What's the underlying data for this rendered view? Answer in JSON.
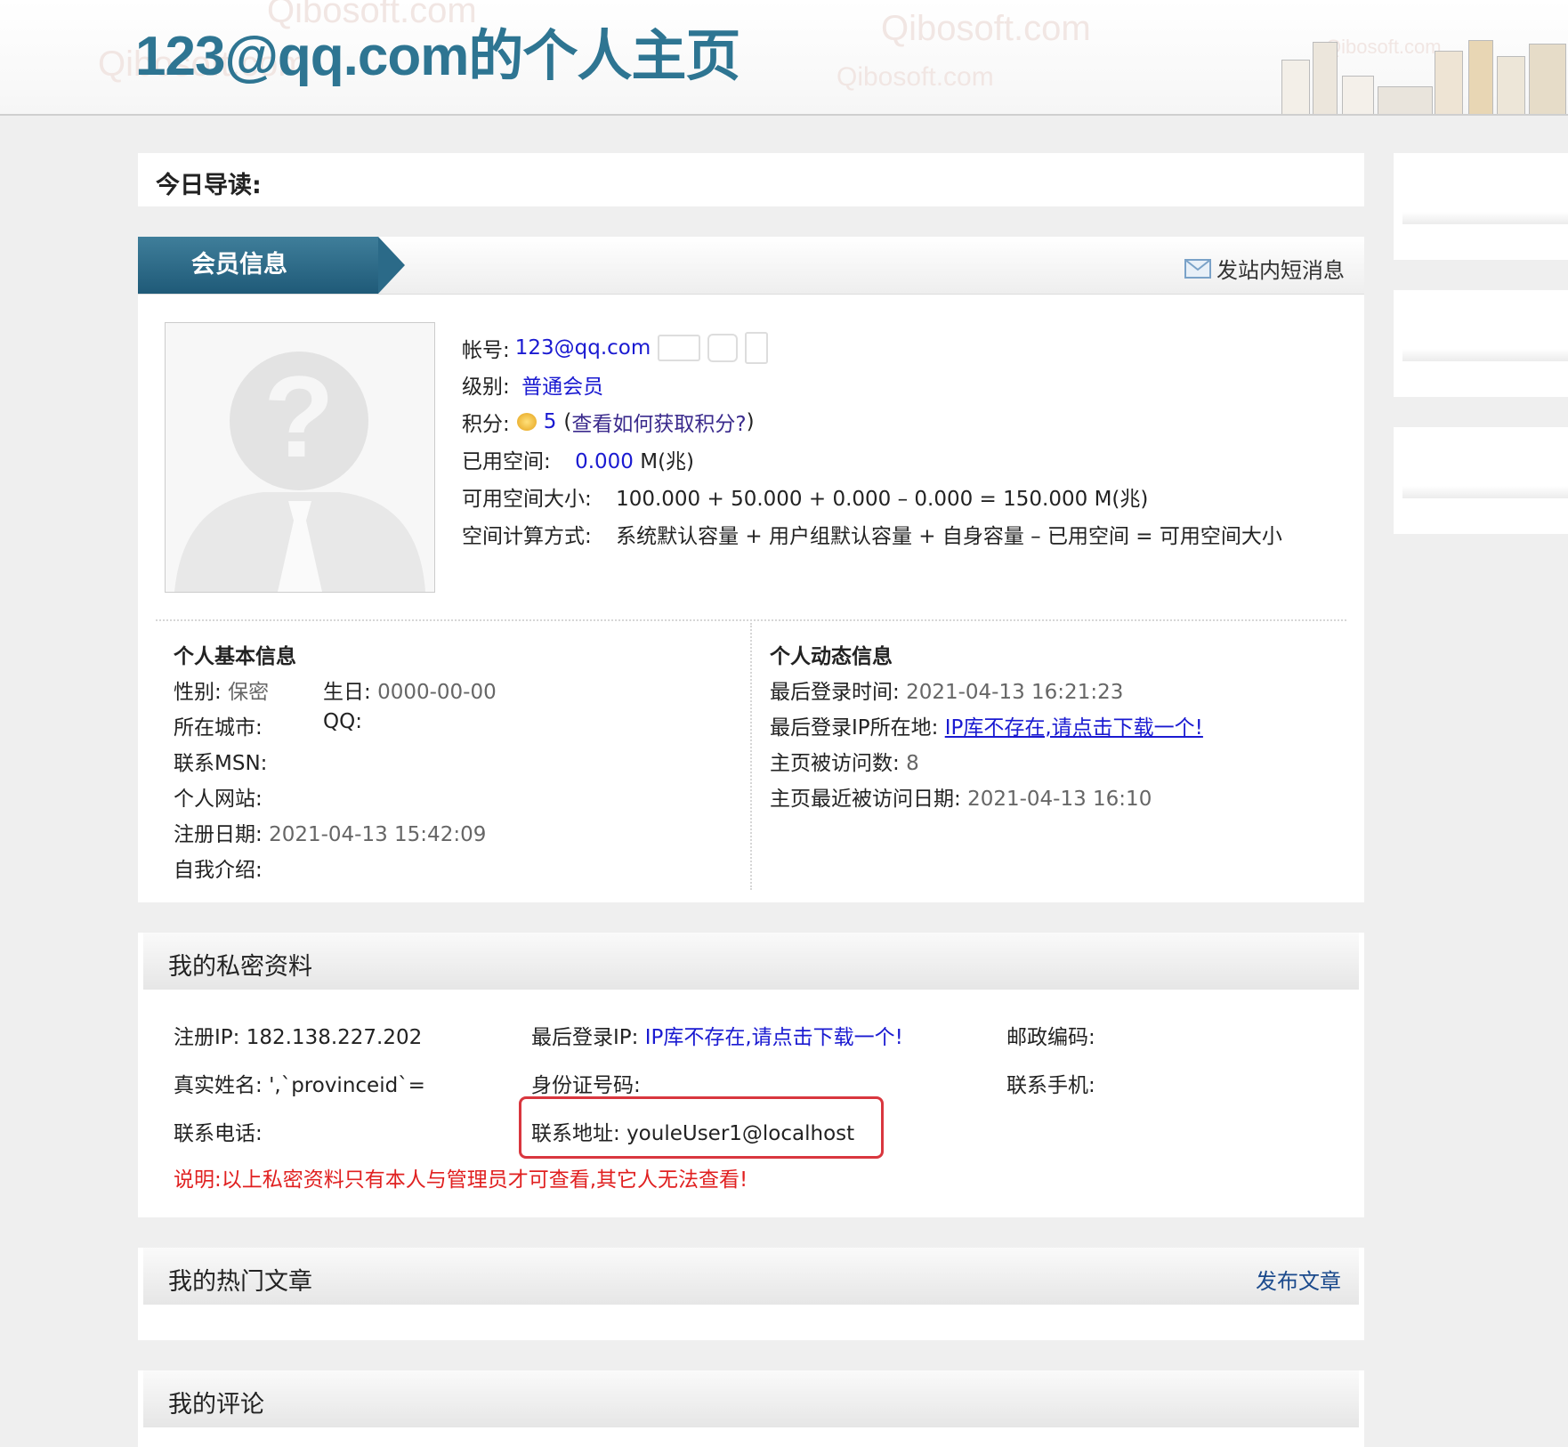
{
  "header": {
    "title": "123@qq.com的个人主页",
    "watermark": "Qibosoft.com"
  },
  "today": {
    "label": "今日导读:"
  },
  "member": {
    "ribbon": "会员信息",
    "message_link": "发站内短消息",
    "account_label": "帐号:",
    "account": "123@qq.com",
    "level_label": "级别:",
    "level": "普通会员",
    "points_label": "积分:",
    "points": "5",
    "points_open": "(",
    "points_link": "查看如何获取积分?",
    "points_close": ")",
    "used_label": "已用空间:",
    "used_value": "0.000",
    "used_unit": "M(兆)",
    "avail_label": "可用空间大小:",
    "avail_value": "100.000 + 50.000 + 0.000 – 0.000 = 150.000 M(兆)",
    "calc_label": "空间计算方式:",
    "calc_value": "系统默认容量 + 用户组默认容量 + 自身容量 – 已用空间 = 可用空间大小"
  },
  "basic": {
    "heading": "个人基本信息",
    "gender_label": "性别:",
    "gender": "保密",
    "birthday_label": "生日:",
    "birthday": "0000-00-00",
    "city_label": "所在城市:",
    "qq_label": "QQ:",
    "msn_label": "联系MSN:",
    "website_label": "个人网站:",
    "reg_label": "注册日期:",
    "reg_date": "2021-04-13 15:42:09",
    "intro_label": "自我介绍:"
  },
  "activity": {
    "heading": "个人动态信息",
    "last_login_label": "最后登录时间:",
    "last_login": "2021-04-13 16:21:23",
    "ip_loc_label": "最后登录IP所在地:",
    "ip_loc_link": "IP库不存在,请点击下载一个!",
    "visits_label": "主页被访问数:",
    "visits": "8",
    "last_visit_label": "主页最近被访问日期:",
    "last_visit": "2021-04-13 16:10"
  },
  "private": {
    "title": "我的私密资料",
    "reg_ip_label": "注册IP:",
    "reg_ip": "182.138.227.202",
    "last_ip_label": "最后登录IP:",
    "last_ip": "IP库不存在,请点击下载一个!",
    "postcode_label": "邮政编码:",
    "realname_label": "真实姓名:",
    "realname": "',`provinceid`=",
    "idcard_label": "身份证号码:",
    "mobile_label": "联系手机:",
    "phone_label": "联系电话:",
    "address_label": "联系地址:",
    "address": "youleUser1@localhost",
    "note": "说明:以上私密资料只有本人与管理员才可查看,其它人无法查看!"
  },
  "articles": {
    "title": "我的热门文章",
    "publish_link": "发布文章"
  },
  "comments": {
    "title": "我的评论"
  },
  "colors": {
    "title": "#2e7592",
    "link": "#1a1ad1",
    "note": "#e02020",
    "highlight": "#d9363e"
  }
}
